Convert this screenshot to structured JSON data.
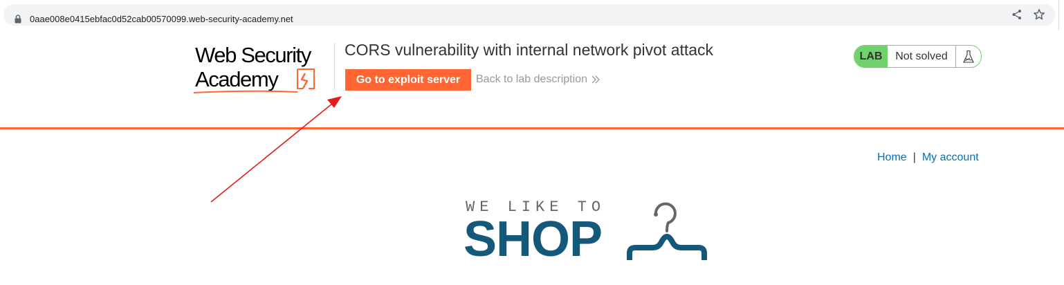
{
  "browser": {
    "url": "0aae008e0415ebfac0d52cab00570099.web-security-academy.net"
  },
  "header": {
    "logo_line1": "Web Security",
    "logo_line2": "Academy",
    "lab_title": "CORS vulnerability with internal network pivot attack",
    "exploit_button": "Go to exploit server",
    "back_link": "Back to lab description",
    "status_badge": "LAB",
    "status_text": "Not solved"
  },
  "nav": {
    "home": "Home",
    "separator": "|",
    "my_account": "My account"
  },
  "shop_logo": {
    "tagline": "WE LIKE TO",
    "wordmark": "SHOP"
  },
  "colors": {
    "accent": "#ff6633",
    "status_green": "#70d16d",
    "link_blue": "#0071bc",
    "shop_blue": "#145979",
    "annotation_red": "#e31b1b"
  },
  "icons": [
    "lock-icon",
    "share-icon",
    "star-icon",
    "chevron-double-right-icon",
    "flask-icon",
    "hanger-icon"
  ]
}
